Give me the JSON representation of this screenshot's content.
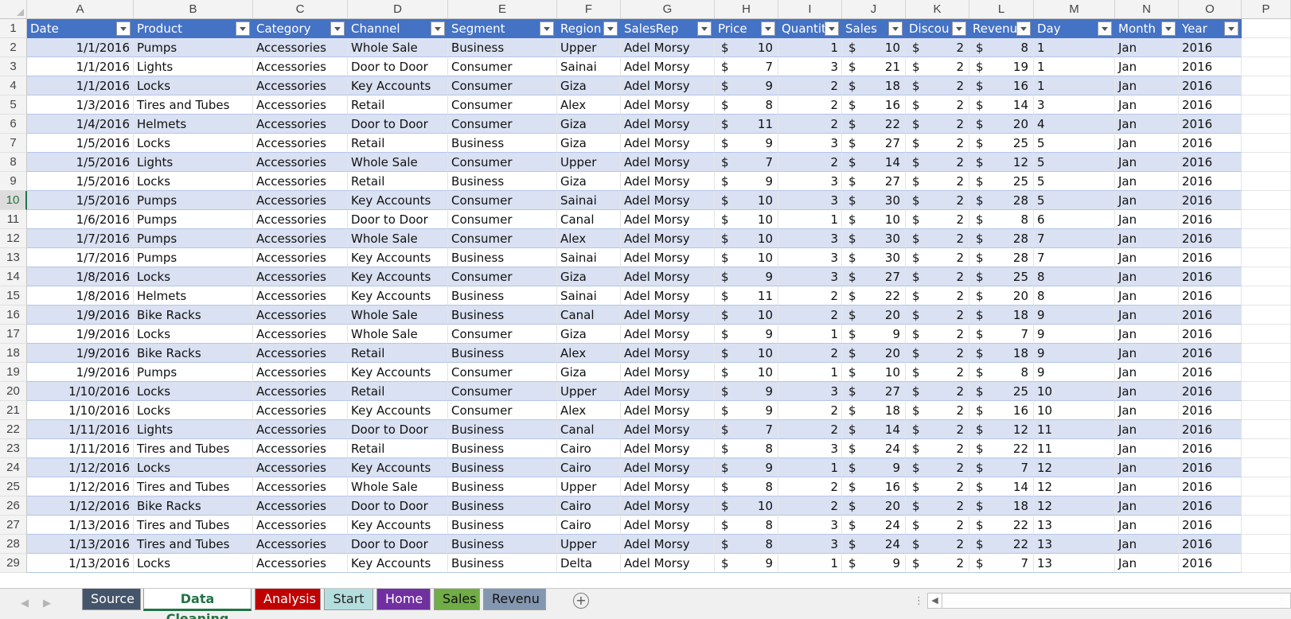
{
  "columns": [
    {
      "letter": "A",
      "width": 134
    },
    {
      "letter": "B",
      "width": 150
    },
    {
      "letter": "C",
      "width": 119
    },
    {
      "letter": "D",
      "width": 126
    },
    {
      "letter": "E",
      "width": 137
    },
    {
      "letter": "F",
      "width": 80
    },
    {
      "letter": "G",
      "width": 118
    },
    {
      "letter": "H",
      "width": 80
    },
    {
      "letter": "I",
      "width": 80
    },
    {
      "letter": "J",
      "width": 80
    },
    {
      "letter": "K",
      "width": 80
    },
    {
      "letter": "L",
      "width": 81
    },
    {
      "letter": "M",
      "width": 102
    },
    {
      "letter": "N",
      "width": 80
    },
    {
      "letter": "O",
      "width": 79
    },
    {
      "letter": "P",
      "width": 62
    }
  ],
  "headers": [
    "Date",
    "Product",
    "Category",
    "Channel",
    "Segment",
    "Region",
    "SalesRep",
    "Price",
    "Quantit",
    "Sales",
    "Discou",
    "Revenu",
    "Day",
    "Month",
    "Year"
  ],
  "rows": [
    {
      "n": "2",
      "c": [
        "1/1/2016",
        "Pumps",
        "Accessories",
        "Whole Sale",
        "Business",
        "Upper",
        "Adel Morsy",
        "10",
        "1",
        "10",
        "2",
        "8",
        "1",
        "Jan",
        "2016"
      ]
    },
    {
      "n": "3",
      "c": [
        "1/1/2016",
        "Lights",
        "Accessories",
        "Door to Door",
        "Consumer",
        "Sainai",
        "Adel Morsy",
        "7",
        "3",
        "21",
        "2",
        "19",
        "1",
        "Jan",
        "2016"
      ]
    },
    {
      "n": "4",
      "c": [
        "1/1/2016",
        "Locks",
        "Accessories",
        "Key Accounts",
        "Consumer",
        "Giza",
        "Adel Morsy",
        "9",
        "2",
        "18",
        "2",
        "16",
        "1",
        "Jan",
        "2016"
      ]
    },
    {
      "n": "5",
      "c": [
        "1/3/2016",
        "Tires and Tubes",
        "Accessories",
        "Retail",
        "Consumer",
        "Alex",
        "Adel Morsy",
        "8",
        "2",
        "16",
        "2",
        "14",
        "3",
        "Jan",
        "2016"
      ]
    },
    {
      "n": "6",
      "c": [
        "1/4/2016",
        "Helmets",
        "Accessories",
        "Door to Door",
        "Consumer",
        "Giza",
        "Adel Morsy",
        "11",
        "2",
        "22",
        "2",
        "20",
        "4",
        "Jan",
        "2016"
      ]
    },
    {
      "n": "7",
      "c": [
        "1/5/2016",
        "Locks",
        "Accessories",
        "Retail",
        "Business",
        "Giza",
        "Adel Morsy",
        "9",
        "3",
        "27",
        "2",
        "25",
        "5",
        "Jan",
        "2016"
      ]
    },
    {
      "n": "8",
      "c": [
        "1/5/2016",
        "Lights",
        "Accessories",
        "Whole Sale",
        "Consumer",
        "Upper",
        "Adel Morsy",
        "7",
        "2",
        "14",
        "2",
        "12",
        "5",
        "Jan",
        "2016"
      ]
    },
    {
      "n": "9",
      "c": [
        "1/5/2016",
        "Locks",
        "Accessories",
        "Retail",
        "Business",
        "Giza",
        "Adel Morsy",
        "9",
        "3",
        "27",
        "2",
        "25",
        "5",
        "Jan",
        "2016"
      ]
    },
    {
      "n": "10",
      "c": [
        "1/5/2016",
        "Pumps",
        "Accessories",
        "Key Accounts",
        "Consumer",
        "Sainai",
        "Adel Morsy",
        "10",
        "3",
        "30",
        "2",
        "28",
        "5",
        "Jan",
        "2016"
      ]
    },
    {
      "n": "11",
      "c": [
        "1/6/2016",
        "Pumps",
        "Accessories",
        "Door to Door",
        "Consumer",
        "Canal",
        "Adel Morsy",
        "10",
        "1",
        "10",
        "2",
        "8",
        "6",
        "Jan",
        "2016"
      ]
    },
    {
      "n": "12",
      "c": [
        "1/7/2016",
        "Pumps",
        "Accessories",
        "Whole Sale",
        "Consumer",
        "Alex",
        "Adel Morsy",
        "10",
        "3",
        "30",
        "2",
        "28",
        "7",
        "Jan",
        "2016"
      ]
    },
    {
      "n": "13",
      "c": [
        "1/7/2016",
        "Pumps",
        "Accessories",
        "Key Accounts",
        "Business",
        "Sainai",
        "Adel Morsy",
        "10",
        "3",
        "30",
        "2",
        "28",
        "7",
        "Jan",
        "2016"
      ]
    },
    {
      "n": "14",
      "c": [
        "1/8/2016",
        "Locks",
        "Accessories",
        "Key Accounts",
        "Consumer",
        "Giza",
        "Adel Morsy",
        "9",
        "3",
        "27",
        "2",
        "25",
        "8",
        "Jan",
        "2016"
      ]
    },
    {
      "n": "15",
      "c": [
        "1/8/2016",
        "Helmets",
        "Accessories",
        "Key Accounts",
        "Business",
        "Sainai",
        "Adel Morsy",
        "11",
        "2",
        "22",
        "2",
        "20",
        "8",
        "Jan",
        "2016"
      ]
    },
    {
      "n": "16",
      "c": [
        "1/9/2016",
        "Bike Racks",
        "Accessories",
        "Whole Sale",
        "Business",
        "Canal",
        "Adel Morsy",
        "10",
        "2",
        "20",
        "2",
        "18",
        "9",
        "Jan",
        "2016"
      ]
    },
    {
      "n": "17",
      "c": [
        "1/9/2016",
        "Locks",
        "Accessories",
        "Whole Sale",
        "Consumer",
        "Giza",
        "Adel Morsy",
        "9",
        "1",
        "9",
        "2",
        "7",
        "9",
        "Jan",
        "2016"
      ]
    },
    {
      "n": "18",
      "c": [
        "1/9/2016",
        "Bike Racks",
        "Accessories",
        "Retail",
        "Business",
        "Alex",
        "Adel Morsy",
        "10",
        "2",
        "20",
        "2",
        "18",
        "9",
        "Jan",
        "2016"
      ]
    },
    {
      "n": "19",
      "c": [
        "1/9/2016",
        "Pumps",
        "Accessories",
        "Key Accounts",
        "Consumer",
        "Giza",
        "Adel Morsy",
        "10",
        "1",
        "10",
        "2",
        "8",
        "9",
        "Jan",
        "2016"
      ]
    },
    {
      "n": "20",
      "c": [
        "1/10/2016",
        "Locks",
        "Accessories",
        "Retail",
        "Consumer",
        "Upper",
        "Adel Morsy",
        "9",
        "3",
        "27",
        "2",
        "25",
        "10",
        "Jan",
        "2016"
      ]
    },
    {
      "n": "21",
      "c": [
        "1/10/2016",
        "Locks",
        "Accessories",
        "Key Accounts",
        "Consumer",
        "Alex",
        "Adel Morsy",
        "9",
        "2",
        "18",
        "2",
        "16",
        "10",
        "Jan",
        "2016"
      ]
    },
    {
      "n": "22",
      "c": [
        "1/11/2016",
        "Lights",
        "Accessories",
        "Door to Door",
        "Business",
        "Canal",
        "Adel Morsy",
        "7",
        "2",
        "14",
        "2",
        "12",
        "11",
        "Jan",
        "2016"
      ]
    },
    {
      "n": "23",
      "c": [
        "1/11/2016",
        "Tires and Tubes",
        "Accessories",
        "Retail",
        "Business",
        "Cairo",
        "Adel Morsy",
        "8",
        "3",
        "24",
        "2",
        "22",
        "11",
        "Jan",
        "2016"
      ]
    },
    {
      "n": "24",
      "c": [
        "1/12/2016",
        "Locks",
        "Accessories",
        "Key Accounts",
        "Business",
        "Cairo",
        "Adel Morsy",
        "9",
        "1",
        "9",
        "2",
        "7",
        "12",
        "Jan",
        "2016"
      ]
    },
    {
      "n": "25",
      "c": [
        "1/12/2016",
        "Tires and Tubes",
        "Accessories",
        "Whole Sale",
        "Business",
        "Upper",
        "Adel Morsy",
        "8",
        "2",
        "16",
        "2",
        "14",
        "12",
        "Jan",
        "2016"
      ]
    },
    {
      "n": "26",
      "c": [
        "1/12/2016",
        "Bike Racks",
        "Accessories",
        "Door to Door",
        "Business",
        "Cairo",
        "Adel Morsy",
        "10",
        "2",
        "20",
        "2",
        "18",
        "12",
        "Jan",
        "2016"
      ]
    },
    {
      "n": "27",
      "c": [
        "1/13/2016",
        "Tires and Tubes",
        "Accessories",
        "Key Accounts",
        "Business",
        "Cairo",
        "Adel Morsy",
        "8",
        "3",
        "24",
        "2",
        "22",
        "13",
        "Jan",
        "2016"
      ]
    },
    {
      "n": "28",
      "c": [
        "1/13/2016",
        "Tires and Tubes",
        "Accessories",
        "Door to Door",
        "Business",
        "Upper",
        "Adel Morsy",
        "8",
        "3",
        "24",
        "2",
        "22",
        "13",
        "Jan",
        "2016"
      ]
    },
    {
      "n": "29",
      "c": [
        "1/13/2016",
        "Locks",
        "Accessories",
        "Key Accounts",
        "Business",
        "Delta",
        "Adel Morsy",
        "9",
        "1",
        "9",
        "2",
        "7",
        "13",
        "Jan",
        "2016"
      ]
    }
  ],
  "currency_symbol": "$",
  "currency_columns": [
    7,
    9,
    10,
    11
  ],
  "right_columns": [
    0,
    8
  ],
  "active_row": "10",
  "tabs": [
    {
      "label": "Source",
      "bg": "#44546a",
      "fg": "#ffffff"
    },
    {
      "label": "Data Cleaning",
      "bg": "#ffffff",
      "fg": "#217346",
      "active": true
    },
    {
      "label": "Analysis",
      "bg": "#c00000",
      "fg": "#ffffff"
    },
    {
      "label": "Start",
      "bg": "#b4dede",
      "fg": "#222222"
    },
    {
      "label": "Home",
      "bg": "#7030a0",
      "fg": "#ffffff"
    },
    {
      "label": "Sales",
      "bg": "#70ad47",
      "fg": "#111111"
    },
    {
      "label": "Revenu",
      "bg": "#8497b0",
      "fg": "#111111"
    }
  ],
  "colors": {
    "header_blue": "#4472c4",
    "band_blue": "#d9e1f2",
    "excel_green": "#217346"
  }
}
